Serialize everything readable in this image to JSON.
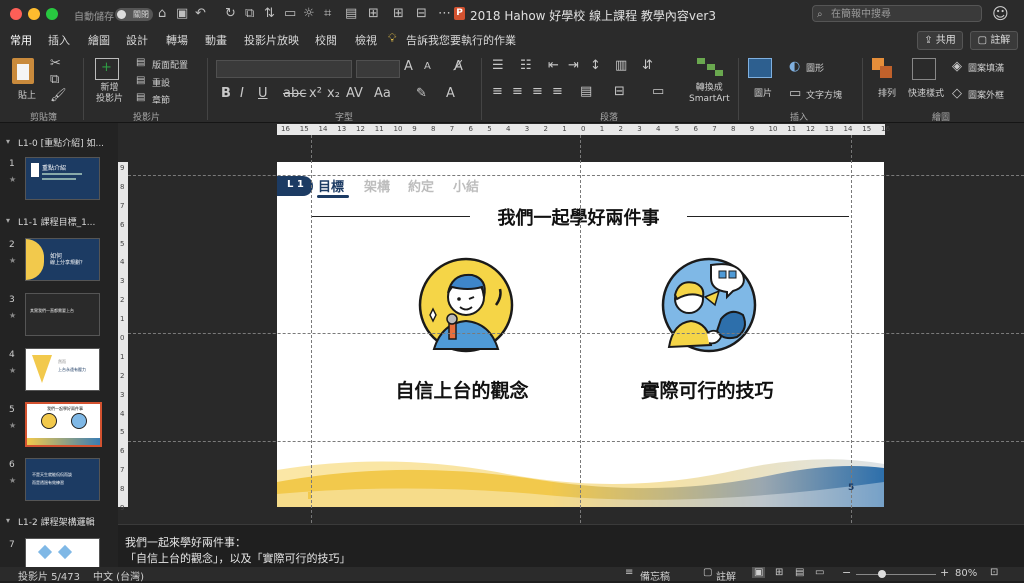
{
  "titlebar": {
    "autosave_label": "自動儲存",
    "toggle_label": "關閉",
    "title": "2018 Hahow 好學校 線上課程 教學內容ver3",
    "search_placeholder": "在簡報中搜尋",
    "light_colors": [
      "#fd5f57",
      "#febc2e",
      "#28c840"
    ]
  },
  "ribbon_tabs": [
    "常用",
    "插入",
    "繪圖",
    "設計",
    "轉場",
    "動畫",
    "投影片放映",
    "校閱",
    "檢視"
  ],
  "tell_me": "告訴我您要執行的作業",
  "share_label": "共用",
  "comment_label": "註解",
  "ribbon": {
    "paste": "貼上",
    "new_slide": "新增\n投影片",
    "layout": "版面配置",
    "reset": "重設",
    "section": "章節",
    "convert_smartart": "轉換成\nSmartArt",
    "picture": "圖片",
    "shapes": "圖形",
    "textbox": "文字方塊",
    "arrange": "排列",
    "quick_styles": "快速樣式",
    "shape_fill": "圖案填滿",
    "shape_outline": "圖案外框",
    "groups": [
      "剪貼簿",
      "投影片",
      "字型",
      "段落",
      "插入",
      "繪圖"
    ]
  },
  "sections": [
    {
      "title": "L1-0 [重點介紹] 如..."
    },
    {
      "title": "L1-1 課程目標_1..."
    },
    {
      "title": "L1-2 課程架構邏輯"
    }
  ],
  "thumbnails": [
    {
      "num": "1",
      "line1": "重點介紹",
      "line2": ""
    },
    {
      "num": "2",
      "line1": "如何",
      "line2": "線上分享規劃？"
    },
    {
      "num": "3",
      "line1": "其實我們一直都需要上台",
      "line2": ""
    },
    {
      "num": "4",
      "line1": "然而",
      "line2": "上台永遠有壓力"
    },
    {
      "num": "5",
      "line1": "我們一起學好兩件事",
      "line2": ""
    },
    {
      "num": "6",
      "line1": "不是天生就能侃侃而談",
      "line2": "而是透過有效練習"
    },
    {
      "num": "7",
      "line1": "",
      "line2": ""
    }
  ],
  "slide": {
    "badge": "L 1",
    "nav": [
      "目標",
      "架構",
      "約定",
      "小結"
    ],
    "heading": "我們一起學好兩件事",
    "left_caption": "自信上台的觀念",
    "right_caption": "實際可行的技巧",
    "page_num": "5"
  },
  "ruler_marks": [
    "16",
    "15",
    "14",
    "13",
    "12",
    "11",
    "10",
    "9",
    "8",
    "7",
    "6",
    "5",
    "4",
    "3",
    "2",
    "1",
    "0",
    "1",
    "2",
    "3",
    "4",
    "5",
    "6",
    "7",
    "8",
    "9",
    "10",
    "11",
    "12",
    "13",
    "14",
    "15",
    "16"
  ],
  "vruler_marks": [
    "9",
    "8",
    "7",
    "6",
    "5",
    "4",
    "3",
    "2",
    "1",
    "0",
    "1",
    "2",
    "3",
    "4",
    "5",
    "6",
    "7",
    "8",
    "9"
  ],
  "notes": {
    "line1": "我們一起來學好兩件事：",
    "line2": "「自信上台的觀念」，以及「實際可行的技巧」"
  },
  "status": {
    "slide_counter": "投影片 5/473",
    "language": "中文 (台灣)",
    "notes_btn": "備忘稿",
    "comments_btn": "註解",
    "zoom": "80%"
  },
  "colors": {
    "accent": "#d35230",
    "navy": "#1c3b63",
    "blue": "#3a7db4",
    "gold": "#f2c94c"
  }
}
